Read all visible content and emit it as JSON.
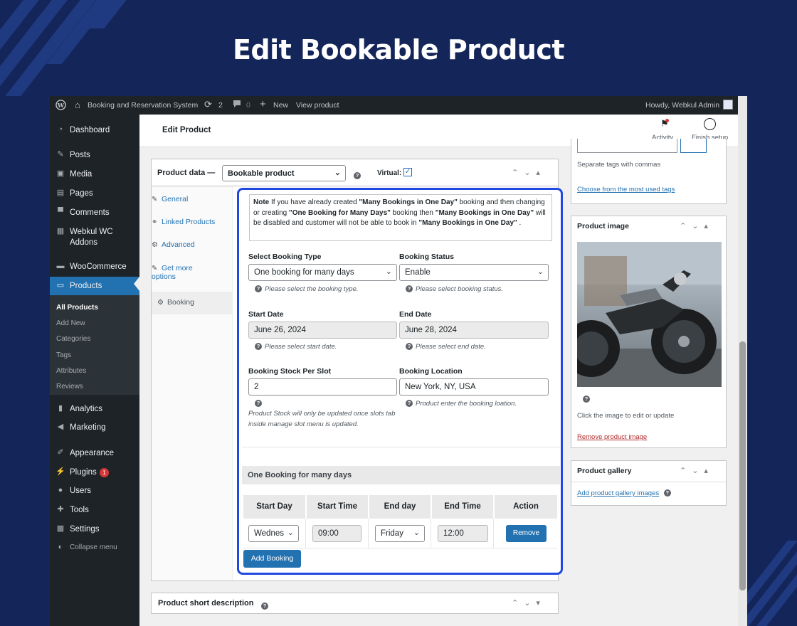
{
  "page_title": "Edit Bookable Product",
  "admin_bar": {
    "site_name": "Booking and Reservation System",
    "updates_count": "2",
    "comments_count": "0",
    "new_label": "New",
    "view_product": "View product",
    "howdy": "Howdy, Webkul Admin"
  },
  "sidebar": {
    "items": [
      {
        "label": "Dashboard",
        "icon": "dashboard-icon"
      },
      {
        "label": "Posts",
        "icon": "pin-icon"
      },
      {
        "label": "Media",
        "icon": "media-icon"
      },
      {
        "label": "Pages",
        "icon": "pages-icon"
      },
      {
        "label": "Comments",
        "icon": "comment-icon"
      },
      {
        "label": "Webkul WC",
        "label2": "Addons",
        "icon": "addons-icon"
      },
      {
        "label": "WooCommerce",
        "icon": "woo-icon"
      },
      {
        "label": "Products",
        "icon": "products-icon"
      },
      {
        "label": "Analytics",
        "icon": "analytics-icon"
      },
      {
        "label": "Marketing",
        "icon": "megaphone-icon"
      },
      {
        "label": "Appearance",
        "icon": "brush-icon"
      },
      {
        "label": "Plugins",
        "badge": "1",
        "icon": "plugin-icon"
      },
      {
        "label": "Users",
        "icon": "user-icon"
      },
      {
        "label": "Tools",
        "icon": "wrench-icon"
      },
      {
        "label": "Settings",
        "icon": "settings-icon"
      },
      {
        "label": "Collapse menu",
        "icon": "collapse-icon"
      }
    ],
    "submenu": [
      "All Products",
      "Add New",
      "Categories",
      "Tags",
      "Attributes",
      "Reviews"
    ]
  },
  "header": {
    "title": "Edit Product",
    "activity": "Activity",
    "finish_setup": "Finish setup"
  },
  "product_data": {
    "label": "Product data —",
    "type_value": "Bookable product",
    "virtual_label": "Virtual:",
    "virtual_checked": true,
    "tabs": [
      "General",
      "Linked Products",
      "Advanced",
      "Get more",
      "options",
      "Booking"
    ]
  },
  "booking": {
    "note_bold": "Note",
    "note_1": " If you have already created ",
    "note_b1": "\"Many Bookings in One Day\"",
    "note_2": " booking and then changing or creating ",
    "note_b2": "\"One Booking for Many Days\"",
    "note_3": " booking then ",
    "note_b3": "\"Many Bookings in One Day\"",
    "note_4": " will be disabled and customer will not be able to book in ",
    "note_b4": "\"Many Bookings in One Day\"",
    "note_5": " .",
    "type_label": "Select Booking Type",
    "type_value": "One booking for many days",
    "type_hint": "Please select the booking type.",
    "status_label": "Booking Status",
    "status_value": "Enable",
    "status_hint": "Please select booking status.",
    "start_label": "Start Date",
    "start_value": "June 26, 2024",
    "start_hint": "Please select start date.",
    "end_label": "End Date",
    "end_value": "June 28, 2024",
    "end_hint": "Please select end date.",
    "stock_label": "Booking Stock Per Slot",
    "stock_value": "2",
    "stock_hint": "Product Stock will only be updated once slots tab inside manage slot menu is updated.",
    "location_label": "Booking Location",
    "location_value": "New York, NY, USA",
    "location_hint": "Product enter the booking loation.",
    "section_title": "One Booking for many days",
    "table_headers": [
      "Start Day",
      "Start Time",
      "End day",
      "End Time",
      "Action"
    ],
    "row": {
      "start_day": "Wednes",
      "start_time": "09:00",
      "end_day": "Friday",
      "end_time": "12:00",
      "action": "Remove"
    },
    "add_button": "Add Booking"
  },
  "right": {
    "tags_hint": "Separate tags with commas",
    "tags_link": "Choose from the most used tags",
    "image_title": "Product image",
    "image_hint": "Click the image to edit or update",
    "remove_image": "Remove product image",
    "gallery_title": "Product gallery",
    "gallery_link": "Add product gallery images"
  },
  "short_description": "Product short description",
  "colors": {
    "accent": "#2271b1",
    "highlight": "#2148e0",
    "background": "#142659"
  }
}
